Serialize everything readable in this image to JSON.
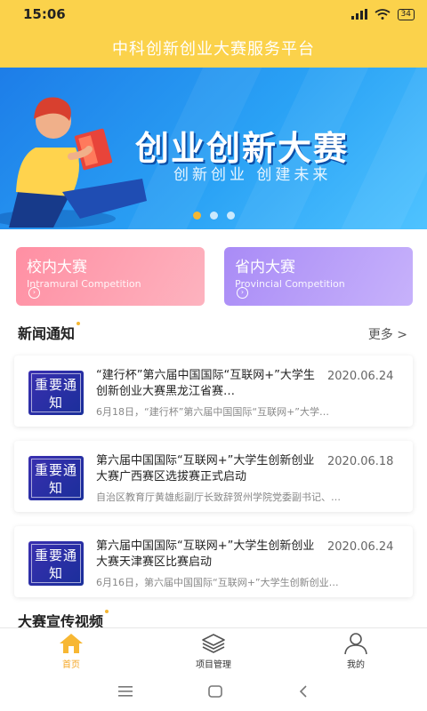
{
  "status_bar": {
    "time": "15:06",
    "battery": "34"
  },
  "header": {
    "title": "中科创新创业大赛服务平台"
  },
  "banner": {
    "title": "创业创新大赛",
    "subtitle": "创新创业 创建未来",
    "active_dot": 0
  },
  "competitions": [
    {
      "title": "校内大赛",
      "subtitle": "Intramural Competition"
    },
    {
      "title": "省内大赛",
      "subtitle": "Provincial Competition"
    }
  ],
  "news": {
    "section_title": "新闻通知",
    "more_label": "更多 >",
    "items": [
      {
        "badge": "重要通知",
        "title": "“建行杯”第六届中国国际“互联网+”大学生创新创业大赛黑龙江省赛…",
        "date": "2020.06.24",
        "summary": "6月18日，“建行杯”第六届中国国际“互联网+”大学…"
      },
      {
        "badge": "重要通知",
        "title": "第六届中国国际“互联网+”大学生创新创业大赛广西赛区选拔赛正式启动",
        "date": "2020.06.18",
        "summary": "自治区教育厅黄雄彪副厅长致辞贺州学院党委副书记、…"
      },
      {
        "badge": "重要通知",
        "title": "第六届中国国际“互联网+”大学生创新创业大赛天津赛区比赛启动",
        "date": "2020.06.24",
        "summary": "6月16日，第六届中国国际“互联网+”大学生创新创业…"
      }
    ]
  },
  "video_section": {
    "title": "大赛宣传视频"
  },
  "tabbar": [
    {
      "label": "首页",
      "icon": "home-icon",
      "active": true
    },
    {
      "label": "项目管理",
      "icon": "layers-icon",
      "active": false
    },
    {
      "label": "我的",
      "icon": "user-icon",
      "active": false
    }
  ],
  "colors": {
    "header": "#fbd24b",
    "accent": "#f5a623",
    "badge": "#2a2fa6"
  }
}
